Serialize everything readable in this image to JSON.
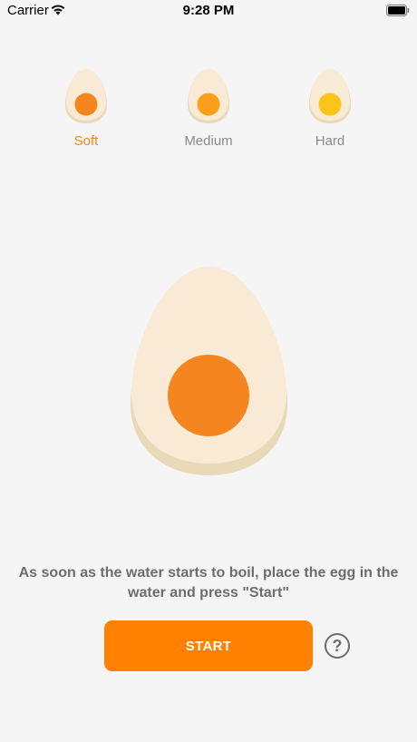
{
  "status_bar": {
    "carrier": "Carrier",
    "time": "9:28 PM"
  },
  "egg_options": [
    {
      "label": "Soft",
      "yolk_color": "#f5861f",
      "selected": true
    },
    {
      "label": "Medium",
      "yolk_color": "#fa9f1b",
      "selected": false
    },
    {
      "label": "Hard",
      "yolk_color": "#fbc418",
      "selected": false
    }
  ],
  "main": {
    "instruction": "As soon as the water starts to boil, place the egg in the water and press \"Start\"",
    "start_label": "START",
    "help_label": "?"
  },
  "colors": {
    "accent": "#ff8101",
    "egg_white": "#f8ead4",
    "egg_shadow": "#e8d9b8",
    "big_yolk": "#f5861f",
    "text_gray": "#6d6d6d",
    "background": "#f5f5f5"
  }
}
